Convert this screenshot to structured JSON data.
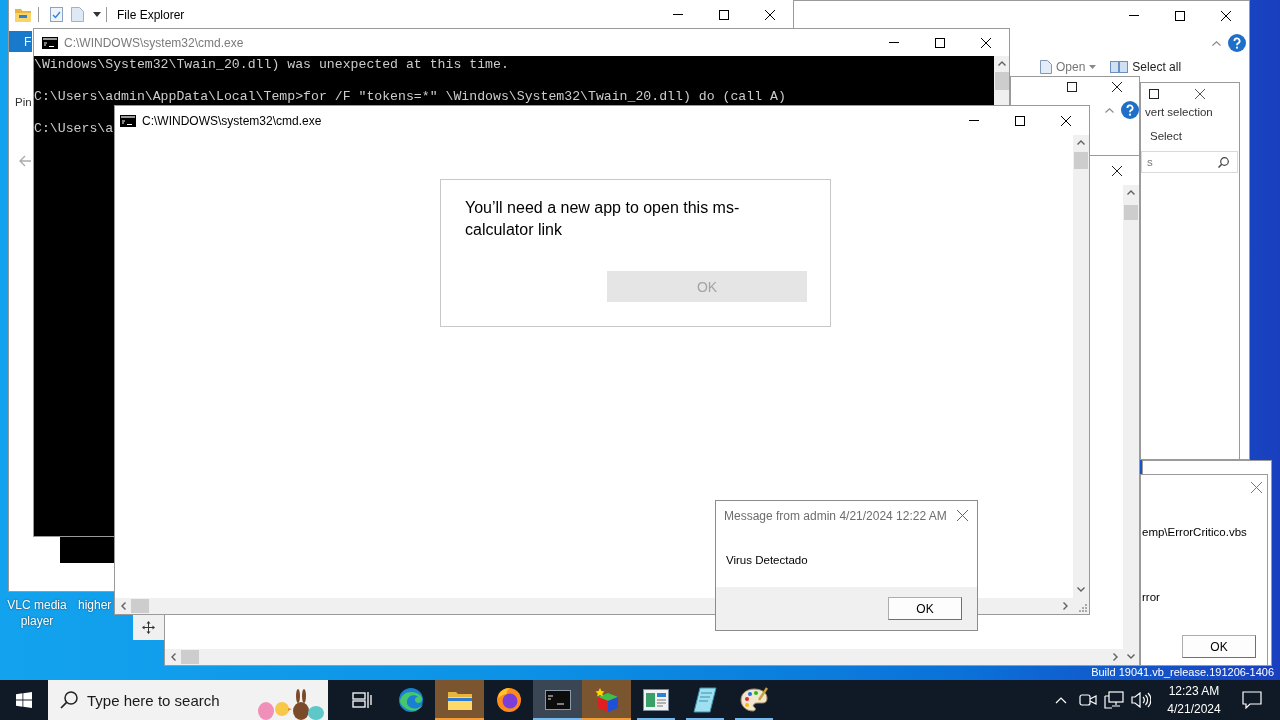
{
  "desktop": {
    "icons": [
      {
        "label": "VLC media player"
      },
      {
        "label": "higher"
      }
    ],
    "build_text": "Build 19041.vb_release.191206-1406"
  },
  "file_explorer": {
    "title": "File Explorer",
    "ribbon_tab": "F",
    "pinned_label": "Pin"
  },
  "explorer_right": {
    "ribbon": [
      "Open",
      "Select all"
    ]
  },
  "explorer_inner": {
    "command": "vert selection",
    "group_label": "Select",
    "search": {
      "placeholder": "s"
    }
  },
  "console_window": {
    "title": "C:\\WINDOWS\\system32\\cmd.exe",
    "active": false,
    "lines": [
      "\\Windows\\System32\\Twain_20.dll) was unexpected at this time.",
      "C:\\Users\\admin\\AppData\\Local\\Temp>for /F \"tokens=*\" \\Windows\\System32\\Twain_20.dll) do (call A)",
      "C:\\Users\\a"
    ]
  },
  "cmd_window": {
    "title": "C:\\WINDOWS\\system32\\cmd.exe",
    "active": true,
    "prompt": {
      "message": "You’ll need a new app to open this ms-calculator link",
      "button": {
        "label": "OK",
        "disabled": true
      }
    }
  },
  "error_dialog": {
    "lines": [
      "emp\\ErrorCritico.vbs",
      "rror"
    ],
    "button": "OK"
  },
  "message_box": {
    "title": "Message from admin 4/21/2024 12:22 AM",
    "text": "Virus Detectado",
    "button": "OK"
  },
  "taskbar": {
    "search": {
      "placeholder": "Type here to search"
    },
    "apps": [
      {
        "kind": "swirl",
        "running": false,
        "attention": false,
        "selected": false
      },
      {
        "kind": "folder",
        "running": true,
        "attention": true,
        "selected": false
      },
      {
        "kind": "fox",
        "running": false,
        "attention": false,
        "selected": false
      },
      {
        "kind": "terminal",
        "running": true,
        "attention": false,
        "selected": true
      },
      {
        "kind": "cube",
        "running": true,
        "attention": true,
        "selected": false
      },
      {
        "kind": "panel",
        "running": true,
        "attention": false,
        "selected": false
      },
      {
        "kind": "note",
        "running": true,
        "attention": false,
        "selected": false
      },
      {
        "kind": "palette",
        "running": true,
        "attention": false,
        "selected": false
      }
    ],
    "clock": {
      "time": "12:23 AM",
      "date": "4/21/2024"
    }
  }
}
